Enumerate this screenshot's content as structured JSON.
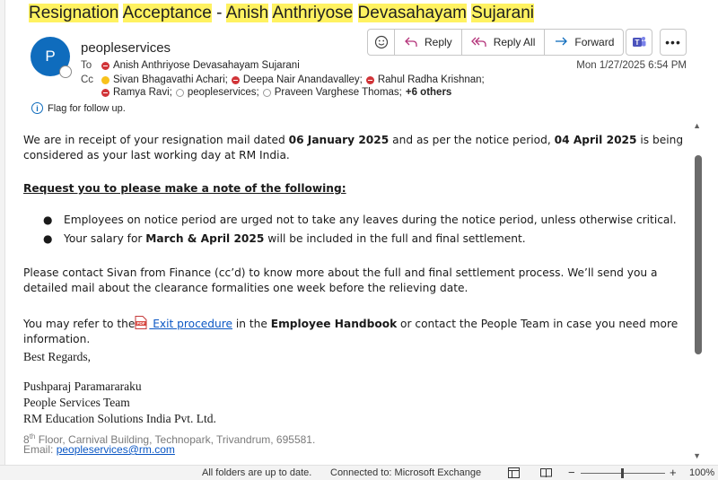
{
  "subject": {
    "words": [
      "Resignation",
      "Acceptance",
      "-",
      "Anish",
      "Anthriyose",
      "Devasahayam",
      "Sujarani"
    ]
  },
  "header": {
    "avatar_initial": "P",
    "sender": "peopleservices",
    "to_label": "To",
    "cc_label": "Cc",
    "to": "Anish Anthriyose Devasahayam Sujarani",
    "cc_line1": [
      "Sivan Bhagavathi Achari;",
      "Deepa Nair Anandavalley;",
      "Rahul Radha Krishnan;"
    ],
    "cc_line2": [
      "Ramya Ravi;",
      "peopleservices;",
      "Praveen Varghese Thomas;"
    ],
    "more_recipients": "+6 others",
    "datetime": "Mon 1/27/2025 6:54 PM",
    "flag_text": "Flag for follow up."
  },
  "toolbar": {
    "reply": "Reply",
    "reply_all": "Reply All",
    "forward": "Forward"
  },
  "body": {
    "p1_a": "We are in receipt of your resignation mail dated ",
    "p1_b": "06 January 2025",
    "p1_c": " and as per the notice period, ",
    "p1_d": "04 April 2025",
    "p1_e": " is being considered as your last working day at RM India.",
    "heading": "Request you to please make a note of the following:",
    "bullet1": "Employees on notice period are urged not to take any leaves during the notice period, unless otherwise critical.",
    "bullet2_a": "Your salary for ",
    "bullet2_b": "March & April 2025",
    "bullet2_c": " will be included in the full and final settlement.",
    "p3": "Please contact Sivan from Finance (cc’d) to know more about the full and final settlement process. We’ll send you a detailed mail about the clearance formalities one week before the relieving date.",
    "p4_a": "You may refer to the",
    "p4_link": " Exit procedure",
    "p4_b": " in the ",
    "p4_c": "Employee Handbook",
    "p4_d": " or contact the People Team in case you need more information.",
    "regards": "Best Regards,",
    "sig_name": "Pushparaj Paramararaku",
    "sig_team": "People Services Team",
    "sig_company": "RM Education Solutions India Pvt. Ltd.",
    "addr_num": "8",
    "addr_sup": "th",
    "addr_rest": " Floor, Carnival Building, Technopark, Trivandrum, 695581.",
    "email_label": "Email: ",
    "email": "peopleservices@rm.com"
  },
  "statusbar": {
    "folders": "All folders are up to date.",
    "connection": "Connected to: Microsoft Exchange",
    "zoom_minus": "−",
    "zoom_plus": "+",
    "zoom": "100%"
  },
  "colors": {
    "highlight": "#fff261",
    "accent": "#0f6cbd",
    "presence_busy": "#d13438",
    "link": "#0b57c4"
  }
}
